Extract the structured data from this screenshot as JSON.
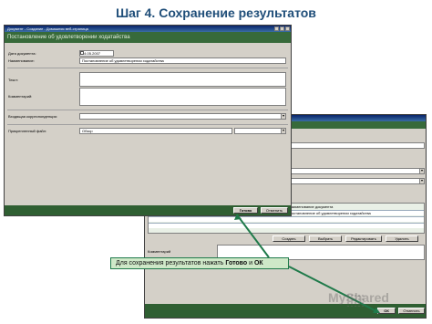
{
  "slide": {
    "title": "Шаг 4. Сохранение результатов"
  },
  "front_window": {
    "title": "Документ - Создание - Домашняя веб-страница",
    "header": "Постановление об удовлетворении ходатайства",
    "fields": {
      "date_label": "Дата документа:",
      "date_value": "04.05.2007",
      "name_label": "Наименование:",
      "name_value": "Постановление об удовлетворении ходатайства",
      "text_label": "Текст:",
      "comment_label": "Комментарий:",
      "incoming_label": "Входящая корреспонденция:",
      "attach_label": "Прикрепленный файл:",
      "attach_value": "Обзор"
    },
    "buttons": {
      "done": "Готово",
      "cancel": "Отменить"
    }
  },
  "back_window": {
    "table": {
      "header": "Наименование документа",
      "rows": [
        "Постановление об удовлетворении ходатайства"
      ]
    },
    "row_buttons": {
      "create": "Создать",
      "select": "Выбрать",
      "edit": "Редактировать",
      "delete": "Удалить"
    },
    "comment_label": "Комментарий",
    "buttons": {
      "ok": "ОК",
      "cancel": "Отменить"
    }
  },
  "callout": {
    "prefix": "Для сохранения результатов нажать ",
    "done_word": "Готово",
    "and": " и ",
    "ok_word": "ОК"
  },
  "watermark": "MyShared",
  "colors": {
    "title": "#1f4e79",
    "band": "#376a3a",
    "arrow": "#1f7a4a",
    "callout_bg": "#cfe8c8"
  }
}
